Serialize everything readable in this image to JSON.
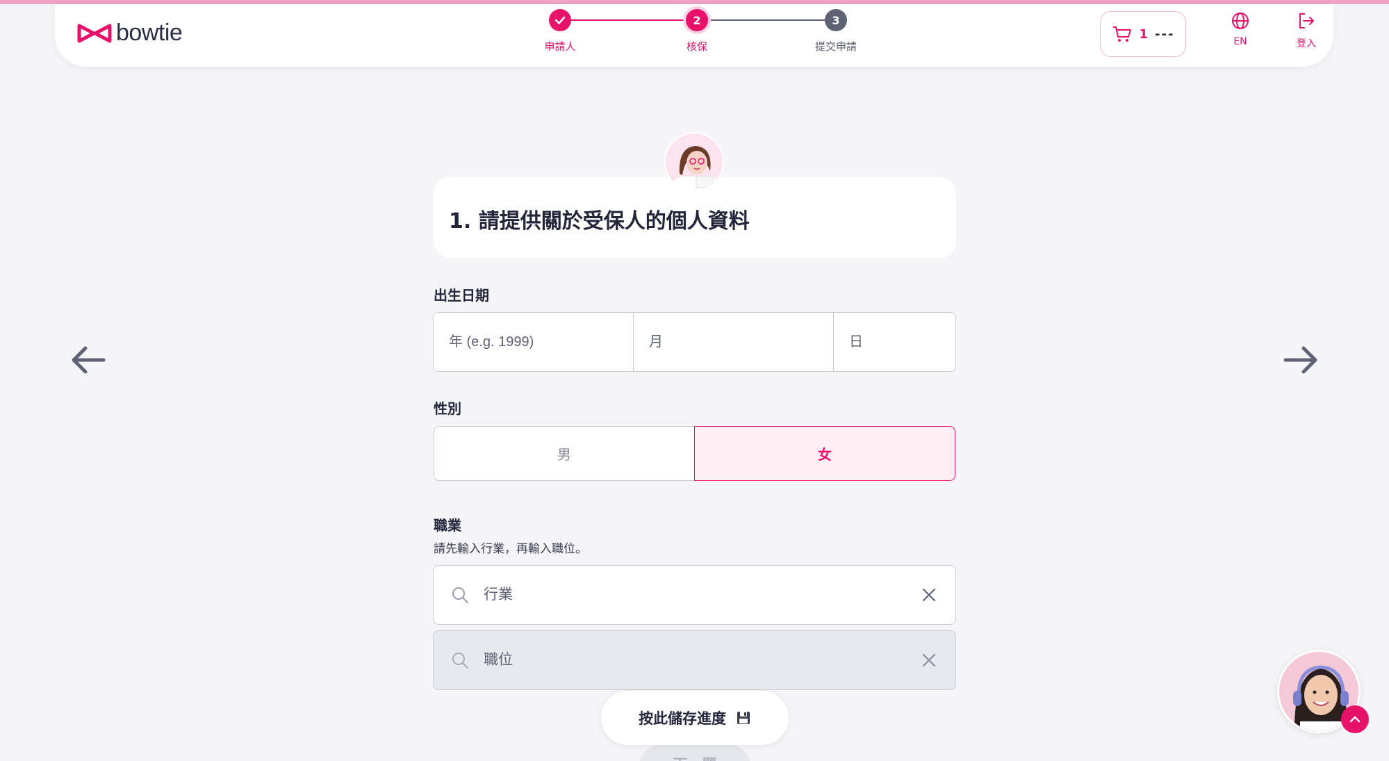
{
  "brand": {
    "name": "bowtie",
    "accent": "#e8126b"
  },
  "stepper": {
    "steps": [
      {
        "number": "1",
        "label": "申請人",
        "status": "completed"
      },
      {
        "number": "2",
        "label": "核保",
        "status": "current"
      },
      {
        "number": "3",
        "label": "提交申請",
        "status": "upcoming"
      }
    ]
  },
  "header": {
    "cart_count": "1",
    "cart_price": "---",
    "language_label": "EN",
    "login_label": "登入"
  },
  "question": {
    "title": "1. 請提供關於受保人的個人資料"
  },
  "dob": {
    "label": "出生日期",
    "year_placeholder": "年 (e.g. 1999)",
    "month_placeholder": "月",
    "day_placeholder": "日"
  },
  "gender": {
    "label": "性別",
    "male": "男",
    "female": "女",
    "selected": "female"
  },
  "occupation": {
    "label": "職業",
    "hint": "請先輸入行業，再輸入職位。",
    "industry_placeholder": "行業",
    "position_placeholder": "職位"
  },
  "actions": {
    "save_label": "按此儲存進度",
    "next_label": "下一題"
  }
}
